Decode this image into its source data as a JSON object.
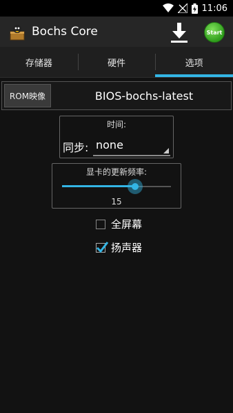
{
  "status_bar": {
    "time": "11:06"
  },
  "action_bar": {
    "title": "Bochs Core",
    "start_label": "Start"
  },
  "tabs": [
    {
      "label": "存储器",
      "active": false
    },
    {
      "label": "硬件",
      "active": false
    },
    {
      "label": "选项",
      "active": true
    }
  ],
  "rom": {
    "button_label": "ROM映像",
    "value": "BIOS-bochs-latest"
  },
  "time_section": {
    "label": "时间:",
    "sync_label": "同步:",
    "sync_value": "none"
  },
  "refresh": {
    "label": "显卡的更新频率:",
    "value": "15",
    "fraction": 0.67
  },
  "options": [
    {
      "label": "全屏幕",
      "checked": false
    },
    {
      "label": "扬声器",
      "checked": true
    }
  ],
  "colors": {
    "accent": "#33b5e5",
    "start": "#3fb526"
  }
}
